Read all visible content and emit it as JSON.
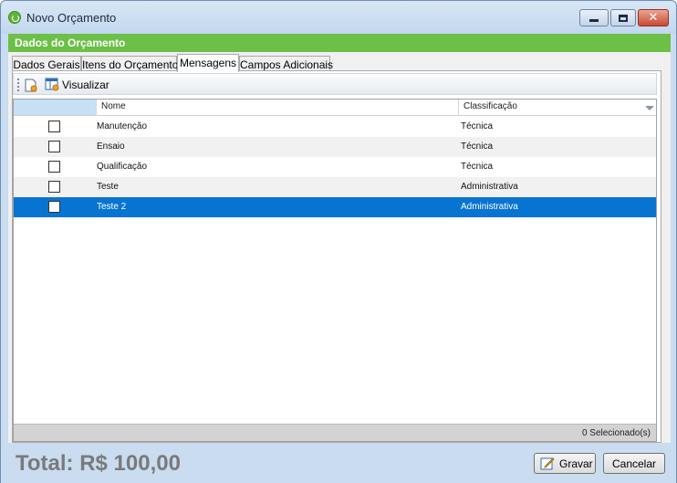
{
  "window": {
    "title": "Novo Orçamento",
    "buttons": {
      "minimize": "minimize-icon",
      "maximize": "maximize-icon",
      "close": "close-icon"
    }
  },
  "section_header": "Dados do Orçamento",
  "tabs": [
    {
      "label": "Dados Gerais",
      "active": false
    },
    {
      "label": "Itens do Orçamento",
      "active": false
    },
    {
      "label": "Mensagens",
      "active": true
    },
    {
      "label": "Campos Adicionais",
      "active": false
    }
  ],
  "toolbar": {
    "new_icon": "new-document-icon",
    "view_icon": "view-icon",
    "view_label": "Visualizar"
  },
  "grid": {
    "columns": [
      "Nome",
      "Classificação"
    ],
    "rows": [
      {
        "checked": false,
        "nome": "Manutenção",
        "classificacao": "Técnica",
        "selected": false
      },
      {
        "checked": false,
        "nome": "Ensaio",
        "classificacao": "Técnica",
        "selected": false
      },
      {
        "checked": false,
        "nome": "Qualificação",
        "classificacao": "Técnica",
        "selected": false
      },
      {
        "checked": false,
        "nome": "Teste",
        "classificacao": "Administrativa",
        "selected": false
      },
      {
        "checked": false,
        "nome": "Teste 2",
        "classificacao": "Administrativa",
        "selected": true
      }
    ],
    "footer": "0 Selecionado(s)"
  },
  "total": "Total: R$ 100,00",
  "buttons": {
    "gravar": "Gravar",
    "cancelar": "Cancelar"
  },
  "colors": {
    "header_green": "#6cbf47",
    "selection_blue": "#0874d2",
    "window_blue": "#c9dcf0"
  }
}
